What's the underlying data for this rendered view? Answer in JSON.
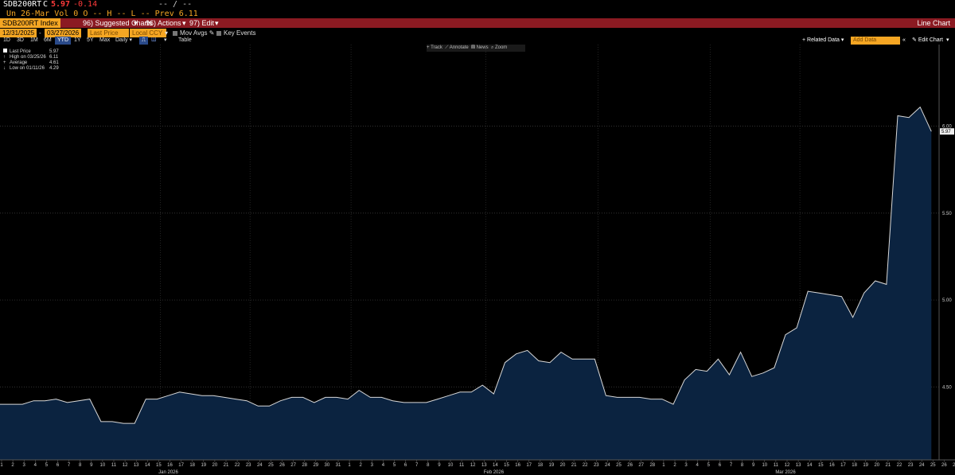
{
  "header": {
    "ticker": "SDB200RT",
    "c_label": "C",
    "last": "5.97",
    "change": "-0.14",
    "blank_right": "-- / --",
    "line2": "Un 26-Mar Vol 0 O -- H -- L -- Prev 6.11"
  },
  "redbar": {
    "security": "SDB200RT Index",
    "suggested": "96) Suggested Charts",
    "actions": "96) Actions",
    "edit": "97) Edit",
    "right_title": "Line Chart"
  },
  "controls": {
    "start_date": "12/31/2025",
    "end_date": "03/27/2026",
    "field": "Last Price",
    "currency": "Local CCY",
    "mov_avgs": "Mov Avgs",
    "key_events": "Key Events",
    "periods": [
      "1D",
      "3D",
      "1M",
      "6M",
      "YTD",
      "1Y",
      "5Y",
      "Max"
    ],
    "frequency": "Daily",
    "table": "Table",
    "related_data": "Related Data",
    "add_data": "Add Data",
    "edit_chart": "Edit Chart"
  },
  "toolbar": {
    "track": "Track",
    "annotate": "Annotate",
    "news": "News",
    "zoom": "Zoom"
  },
  "legend": {
    "last_price_label": "Last Price",
    "last_price_value": "5.97",
    "high_label": "High on 03/25/26",
    "high_value": "6.11",
    "average_label": "Average",
    "average_value": "4.61",
    "low_label": "Low on 01/11/26",
    "low_value": "4.29"
  },
  "chart_data": {
    "type": "area",
    "y_ticks": [
      4.5,
      5.0,
      5.5,
      6.0
    ],
    "ylim": [
      4.08,
      6.47
    ],
    "last_value_label": "5.97",
    "x_day_labels": [
      "1",
      "2",
      "3",
      "4",
      "5",
      "6",
      "7",
      "8",
      "9",
      "10",
      "11",
      "12",
      "13",
      "14",
      "15",
      "16",
      "17",
      "18",
      "19",
      "20",
      "21",
      "22",
      "23",
      "24",
      "25",
      "26",
      "27",
      "28",
      "29",
      "30",
      "31",
      "1",
      "2",
      "3",
      "4",
      "5",
      "6",
      "7",
      "8",
      "9",
      "10",
      "11",
      "12",
      "13",
      "14",
      "15",
      "16",
      "17",
      "18",
      "19",
      "20",
      "21",
      "22",
      "23",
      "24",
      "25",
      "26",
      "27",
      "28",
      "1",
      "2",
      "3",
      "4",
      "5",
      "6",
      "7",
      "8",
      "9",
      "10",
      "11",
      "12",
      "13",
      "14",
      "15",
      "16",
      "17",
      "18",
      "19",
      "20",
      "21",
      "22",
      "23",
      "24",
      "25",
      "26",
      "27"
    ],
    "months": [
      {
        "label": "Jan 2026",
        "at": 15
      },
      {
        "label": "Feb 2026",
        "at": 44
      },
      {
        "label": "Mar 2026",
        "at": 70
      }
    ],
    "points": [
      [
        0,
        4.4
      ],
      [
        1,
        4.4
      ],
      [
        2,
        4.4
      ],
      [
        3,
        4.42
      ],
      [
        4,
        4.42
      ],
      [
        5,
        4.43
      ],
      [
        6,
        4.41
      ],
      [
        7,
        4.42
      ],
      [
        8,
        4.43
      ],
      [
        9,
        4.3
      ],
      [
        10,
        4.3
      ],
      [
        11,
        4.29
      ],
      [
        12,
        4.29
      ],
      [
        13,
        4.43
      ],
      [
        14,
        4.43
      ],
      [
        15,
        4.45
      ],
      [
        16,
        4.47
      ],
      [
        17,
        4.46
      ],
      [
        18,
        4.45
      ],
      [
        19,
        4.45
      ],
      [
        20,
        4.44
      ],
      [
        21,
        4.43
      ],
      [
        22,
        4.42
      ],
      [
        23,
        4.39
      ],
      [
        24,
        4.39
      ],
      [
        25,
        4.42
      ],
      [
        26,
        4.44
      ],
      [
        27,
        4.44
      ],
      [
        28,
        4.41
      ],
      [
        29,
        4.44
      ],
      [
        30,
        4.44
      ],
      [
        31,
        4.43
      ],
      [
        32,
        4.48
      ],
      [
        33,
        4.44
      ],
      [
        34,
        4.44
      ],
      [
        35,
        4.42
      ],
      [
        36,
        4.41
      ],
      [
        37,
        4.41
      ],
      [
        38,
        4.41
      ],
      [
        39,
        4.43
      ],
      [
        40,
        4.45
      ],
      [
        41,
        4.47
      ],
      [
        42,
        4.47
      ],
      [
        43,
        4.51
      ],
      [
        44,
        4.46
      ],
      [
        45,
        4.64
      ],
      [
        46,
        4.69
      ],
      [
        47,
        4.71
      ],
      [
        48,
        4.65
      ],
      [
        49,
        4.64
      ],
      [
        50,
        4.7
      ],
      [
        51,
        4.66
      ],
      [
        52,
        4.66
      ],
      [
        53,
        4.66
      ],
      [
        54,
        4.45
      ],
      [
        55,
        4.44
      ],
      [
        56,
        4.44
      ],
      [
        57,
        4.44
      ],
      [
        58,
        4.43
      ],
      [
        59,
        4.43
      ],
      [
        60,
        4.4
      ],
      [
        61,
        4.54
      ],
      [
        62,
        4.6
      ],
      [
        63,
        4.59
      ],
      [
        64,
        4.66
      ],
      [
        65,
        4.57
      ],
      [
        66,
        4.7
      ],
      [
        67,
        4.56
      ],
      [
        68,
        4.58
      ],
      [
        69,
        4.61
      ],
      [
        70,
        4.8
      ],
      [
        71,
        4.84
      ],
      [
        72,
        5.05
      ],
      [
        73,
        5.04
      ],
      [
        74,
        5.03
      ],
      [
        75,
        5.02
      ],
      [
        76,
        4.9
      ],
      [
        77,
        5.04
      ],
      [
        78,
        5.11
      ],
      [
        79,
        5.09
      ],
      [
        80,
        6.06
      ],
      [
        81,
        6.05
      ],
      [
        82,
        6.11
      ],
      [
        83,
        5.97
      ]
    ]
  }
}
